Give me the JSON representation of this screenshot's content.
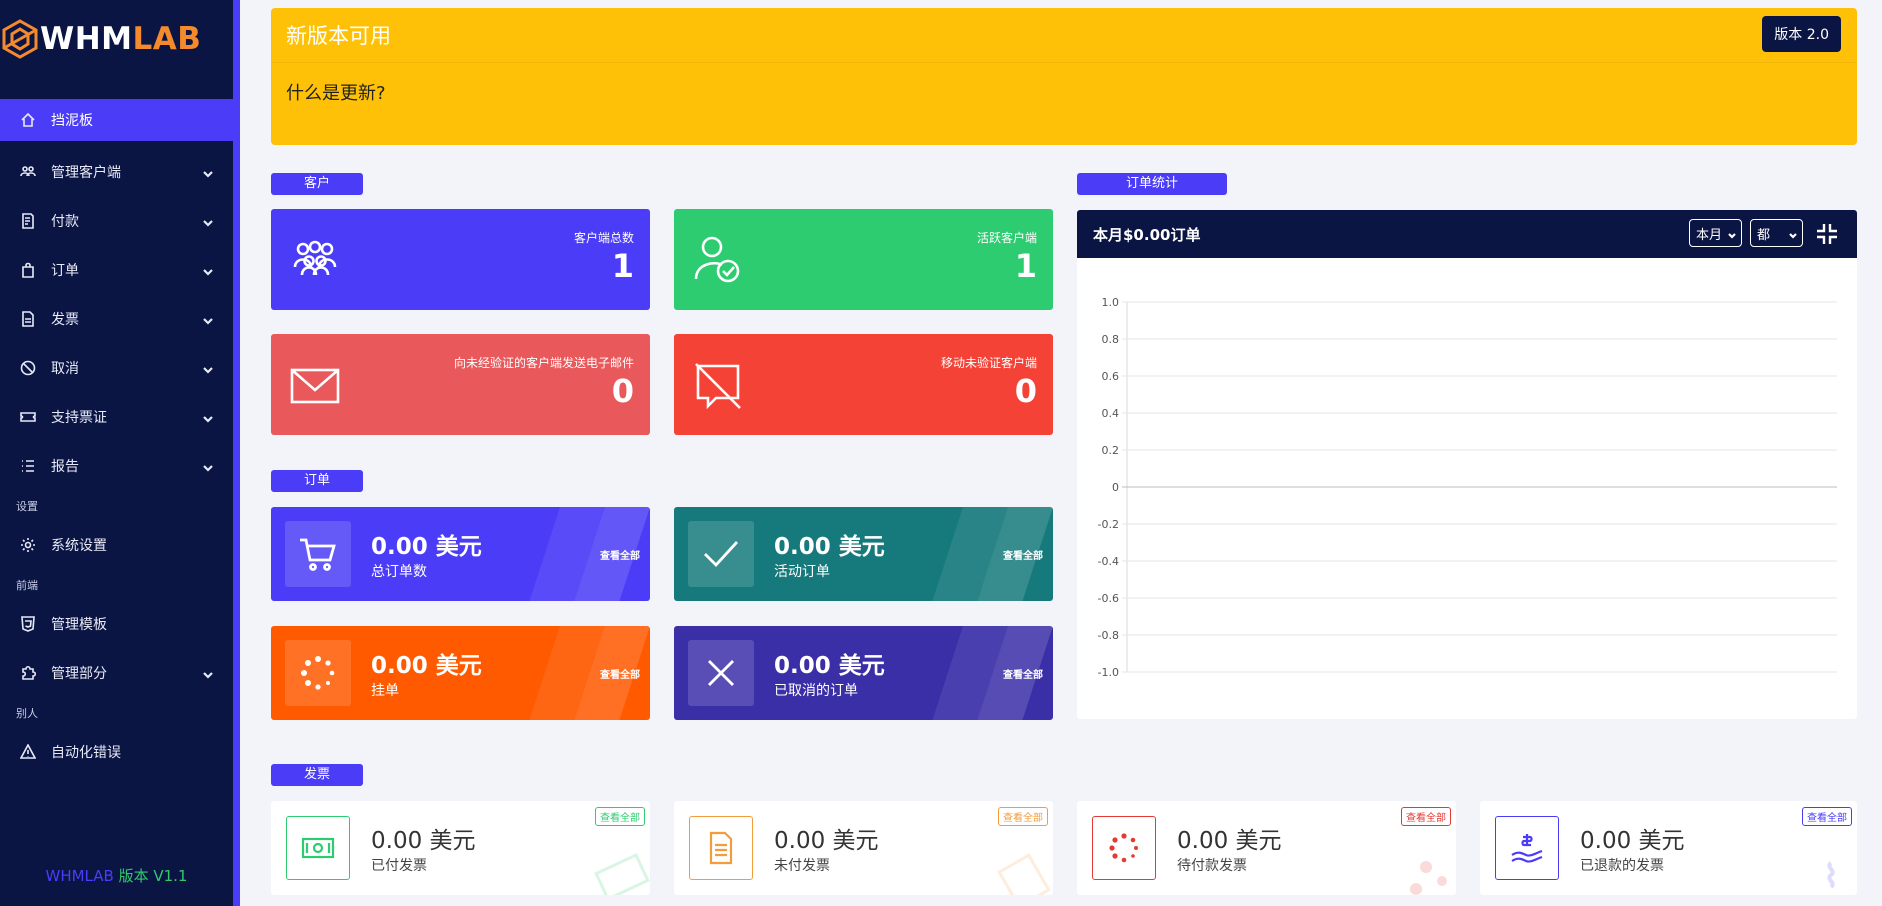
{
  "brand": {
    "logo_w": "WHM",
    "logo_l": "LAB",
    "version_prefix": "WHMLAB",
    "version_suffix": "版本 V1.1"
  },
  "sidebar": {
    "items": [
      {
        "label": "挡泥板",
        "icon": "home-icon",
        "active": true
      },
      {
        "label": "管理客户端",
        "icon": "users-icon",
        "chevron": true
      },
      {
        "label": "付款",
        "icon": "billing-icon",
        "chevron": true
      },
      {
        "label": "订单",
        "icon": "bag-icon",
        "chevron": true
      },
      {
        "label": "发票",
        "icon": "file-icon",
        "chevron": true
      },
      {
        "label": "取消",
        "icon": "cancel-icon",
        "chevron": true
      },
      {
        "label": "支持票证",
        "icon": "ticket-icon",
        "chevron": true
      },
      {
        "label": "报告",
        "icon": "list-icon",
        "chevron": true
      }
    ],
    "section_settings": "设置",
    "settings_item": "系统设置",
    "section_frontend": "前端",
    "frontend_items": [
      "管理模板",
      "管理部分"
    ],
    "section_other": "别人",
    "other_item": "自动化错误"
  },
  "banner": {
    "title": "新版本可用",
    "button": "版本 2.0",
    "body": "什么是更新?"
  },
  "clients": {
    "section": "客户",
    "cards": [
      {
        "label": "客户端总数",
        "value": "1",
        "color": "#4b3cf7"
      },
      {
        "label": "活跃客户端",
        "value": "1",
        "color": "#2ecc71"
      },
      {
        "label": "向未经验证的客户端发送电子邮件",
        "value": "0",
        "color": "#e9585a"
      },
      {
        "label": "移动未验证客户端",
        "value": "0",
        "color": "#f44336"
      }
    ]
  },
  "orders": {
    "section": "订单",
    "view_all": "查看全部",
    "cards": [
      {
        "amount": "0.00 美元",
        "label": "总订单数",
        "color": "#4b3cf7"
      },
      {
        "amount": "0.00 美元",
        "label": "活动订单",
        "color": "#167a7c"
      },
      {
        "amount": "0.00 美元",
        "label": "挂单",
        "color": "#ff5a00"
      },
      {
        "amount": "0.00 美元",
        "label": "已取消的订单",
        "color": "#3b2fa8"
      }
    ]
  },
  "order_stats": {
    "section": "订单统计",
    "header": "本月$0.00订单",
    "period_select": "本月",
    "scope_select": "都"
  },
  "chart_data": {
    "type": "line",
    "series": [],
    "ylim": [
      -1.0,
      1.0
    ],
    "yticks": [
      "1.0",
      "0.8",
      "0.6",
      "0.4",
      "0.2",
      "0",
      "-0.2",
      "-0.4",
      "-0.6",
      "-0.8",
      "-1.0"
    ],
    "grid": true
  },
  "invoices": {
    "section": "发票",
    "view_all": "查看全部",
    "cards": [
      {
        "amount": "0.00 美元",
        "label": "已付发票",
        "color": "#2ecc71"
      },
      {
        "amount": "0.00 美元",
        "label": "未付发票",
        "color": "#f39c3c"
      },
      {
        "amount": "0.00 美元",
        "label": "待付款发票",
        "color": "#e53935"
      },
      {
        "amount": "0.00 美元",
        "label": "已退款的发票",
        "color": "#4b3cf7"
      }
    ]
  }
}
